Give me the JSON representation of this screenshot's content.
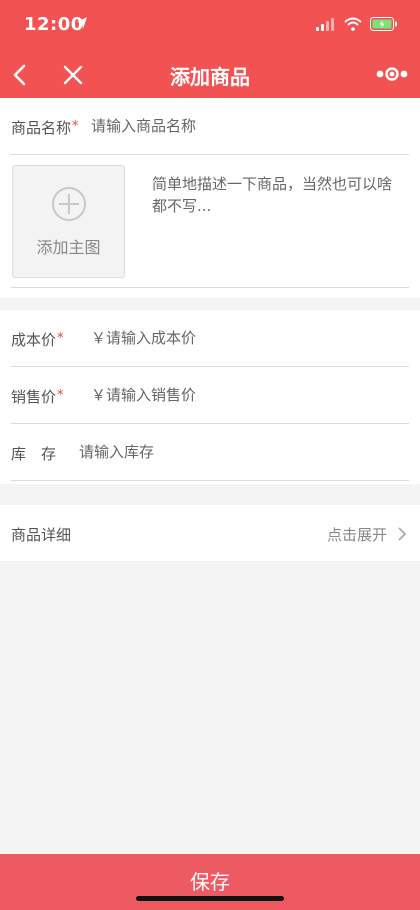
{
  "status_bar": {
    "time": "12:00"
  },
  "nav": {
    "title": "添加商品"
  },
  "form": {
    "name": {
      "label": "商品名称",
      "required_mark": "*",
      "placeholder": "请输入商品名称"
    },
    "image": {
      "add_label": "添加主图"
    },
    "description": {
      "placeholder": "简单地描述一下商品，当然也可以啥都不写..."
    },
    "cost_price": {
      "label": "成本价",
      "required_mark": "*",
      "placeholder": "￥请输入成本价"
    },
    "sale_price": {
      "label": "销售价",
      "required_mark": "*",
      "placeholder": "￥请输入销售价"
    },
    "stock": {
      "label": "库　存",
      "placeholder": "请输入库存"
    }
  },
  "detail": {
    "label": "商品详细",
    "expand_label": "点击展开"
  },
  "footer": {
    "save_label": "保存"
  },
  "colors": {
    "header": "#f25252",
    "save_button": "#ee5a62",
    "required": "#e84545"
  }
}
